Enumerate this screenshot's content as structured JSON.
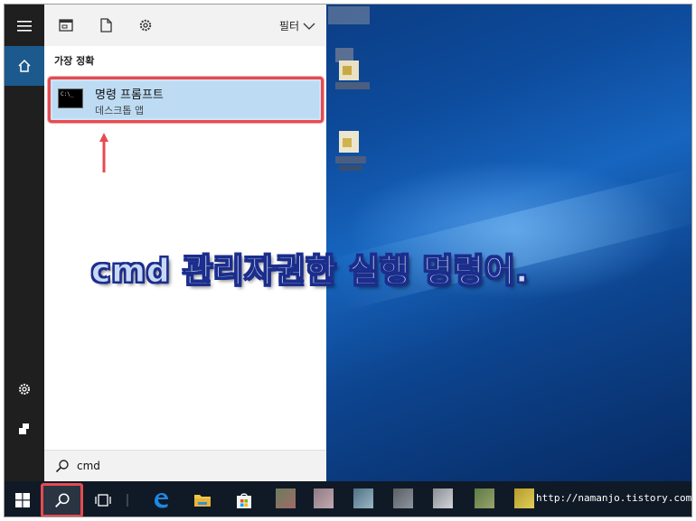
{
  "start_panel": {
    "filter_label": "필터",
    "section_title": "가장 정확",
    "result": {
      "title": "명령 프롬프트",
      "subtitle": "데스크톱 앱",
      "icon_text": "C:\\_"
    },
    "search": {
      "value": "cmd"
    }
  },
  "overlay": {
    "caption": "cmd 관리자권한 실행 명령어."
  },
  "taskbar": {
    "watermark": "http://namanjo.tistory.com"
  },
  "colors": {
    "highlight_border": "#e64b50",
    "selected_item": "#cce4f7",
    "rail": "#1f1f1f",
    "taskbar": "#101a26",
    "caption_fill": "#c9d9f4",
    "caption_outline": "#1d2f8f"
  },
  "icons": {
    "rail": [
      "hamburger-icon",
      "home-icon",
      "settings-icon",
      "user-icon"
    ],
    "toolbar": [
      "apps-icon",
      "document-icon",
      "gear-icon",
      "chevron-down-icon"
    ],
    "taskbar": [
      "windows-icon",
      "search-icon",
      "task-view-icon",
      "edge-icon",
      "file-explorer-icon",
      "store-icon"
    ]
  }
}
